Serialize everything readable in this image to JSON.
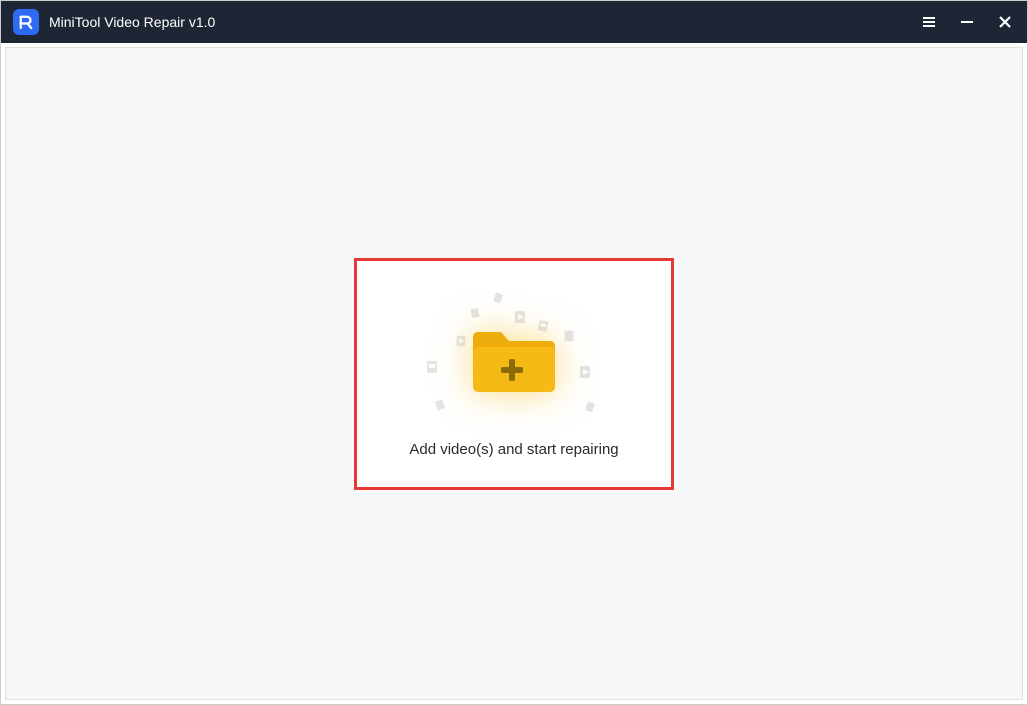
{
  "app": {
    "title": "MiniTool Video Repair v1.0"
  },
  "dropzone": {
    "prompt": "Add video(s) and start repairing"
  },
  "icons": {
    "app": "R",
    "menu": "menu",
    "minimize": "minimize",
    "close": "close",
    "folderPlus": "folder-plus"
  },
  "colors": {
    "titlebar": "#1e2635",
    "accent": "#2f6af5",
    "highlight": "#e53935",
    "folder": "#f5ba16",
    "contentBg": "#f7f8fa"
  }
}
